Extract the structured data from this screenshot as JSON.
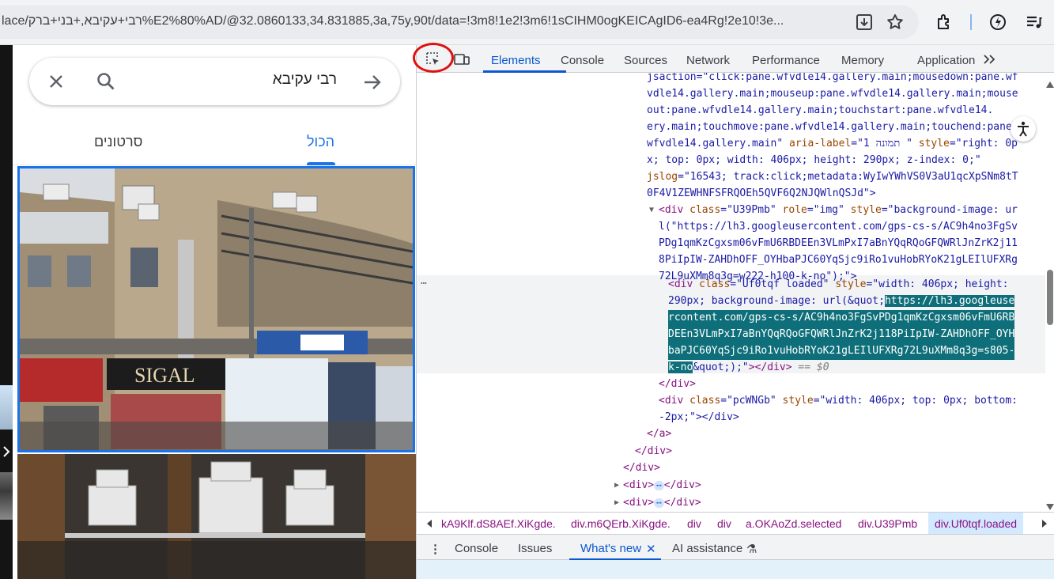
{
  "browser": {
    "url": "lace/רבי+עקיבא,+בני+ברק%E2%80%AD/@32.0860133,34.831885,3a,75y,90t/data=!3m8!1e2!3m6!1sCIHM0ogKEICAgID6-ea4Rg!2e10!3e..."
  },
  "maps": {
    "search_query": "רבי עקיבא",
    "tab_all": "הכול",
    "tab_videos": "סרטונים"
  },
  "devtools": {
    "tabs": [
      "Elements",
      "Console",
      "Sources",
      "Network",
      "Performance",
      "Memory",
      "Application"
    ],
    "code": {
      "l1": "jsaction=\"click:pane.wfvdle14.gallery.main;mousedown:pane.wf",
      "l2": "vdle14.gallery.main;mouseup:pane.wfvdle14.gallery.main;mouse",
      "l3": "out:pane.wfvdle14.gallery.main;touchstart:pane.wfvdle14.",
      "l4": "ery.main;touchmove:pane.wfvdle14.gallery.main;touchend:pane.",
      "l5_a": "wfvdle14.gallery.main\"",
      "l5_b": " aria-label",
      "l5_c": "=\"1 תמונה \"",
      "l5_d": " style",
      "l5_e": "=\"right: 0p",
      "l6": "x; top: 0px; width: 406px; height: 290px; z-index: 0;\"",
      "l7_a": "jslog",
      "l7_b": "=\"16543; track:click;metadata:WyIwYWhVS0V3aU1qcXpSNm8tT",
      "l8": "0F4V1ZEWHNFSFRQOEh5QVF6Q2NJQWlnQSJd\">",
      "l9_a": "<div",
      "l9_b": " class",
      "l9_c": "=\"U39Pmb\"",
      "l9_d": " role",
      "l9_e": "=\"img\"",
      "l9_f": " style",
      "l9_g": "=\"background-image: ur",
      "l10": "l(\"https://lh3.googleusercontent.com/gps-cs-s/AC9h4no3FgSv",
      "l11": "PDg1qmKzCgxsm06vFmU6RBDEEn3VLmPxI7aBnYQqRQoGFQWRlJnZrK2j11",
      "l12": "8PiIpIW-ZAHDhOFF_OYHbaPJC60YqSjc9iRo1vuHobRYoK21gLEIlUFXRg",
      "l13": "72L9uXMm8q3g=w222-h100-k-no\");\">",
      "s1_a": "<div",
      "s1_b": " class",
      "s1_c": "=\"Uf0tqf loaded\"",
      "s1_d": " style",
      "s1_e": "=\"width: 406px; height:",
      "s2_a": "290px; background-image: url(&quot;",
      "s2_b": "https://lh3.googleuse",
      "s3": "rcontent.com/gps-cs-s/AC9h4no3FgSvPDg1qmKzCgxsm06vFmU6RB",
      "s4": "DEEn3VLmPxI7aBnYQqRQoGFQWRlJnZrK2j118PiIpIW-ZAHDhOFF_OYH",
      "s5": "baPJC60YqSjc9iRo1vuHobRYoK21gLEIlUFXRg72L9uXMm8q3g=s805-",
      "s6_a": "k-no",
      "s6_b": "&quot;);\"",
      "s6_c": "></div>",
      "s6_d": " == $0",
      "c1": "</div>",
      "c2_a": "<div",
      "c2_b": " class",
      "c2_c": "=\"pcWNGb\"",
      "c2_d": " style",
      "c2_e": "=\"width: 406px; top: 0px; bottom:",
      "c3": "-2px;\"></div>",
      "c4": "</a>",
      "c5": "</div>",
      "c6": "</div>",
      "c7_a": "<div>",
      "c7_b": "</div>",
      "c8_a": "<div>",
      "c8_b": "</div>"
    },
    "breadcrumbs": [
      "kA9Klf.dS8AEf.XiKgde.",
      "div.m6QErb.XiKgde.",
      "div",
      "div",
      "a.OKAoZd.selected",
      "div.U39Pmb",
      "div.Uf0tqf.loaded"
    ],
    "drawer_tabs": [
      "Console",
      "Issues",
      "What's new",
      "AI assistance"
    ]
  },
  "colors": {
    "accent": "#1a73e8",
    "devtools_active": "#0b57d0",
    "selection_highlight": "#0e6f7a",
    "annotation_circle": "#e01010"
  },
  "icons": [
    "download-icon",
    "bookmark-star-icon",
    "extensions-icon",
    "performance-icon",
    "media-queue-icon",
    "inspect-element-icon",
    "device-toolbar-icon",
    "more-tabs-icon",
    "accessibility-icon",
    "close-icon",
    "search-icon",
    "directions-arrow-icon"
  ]
}
